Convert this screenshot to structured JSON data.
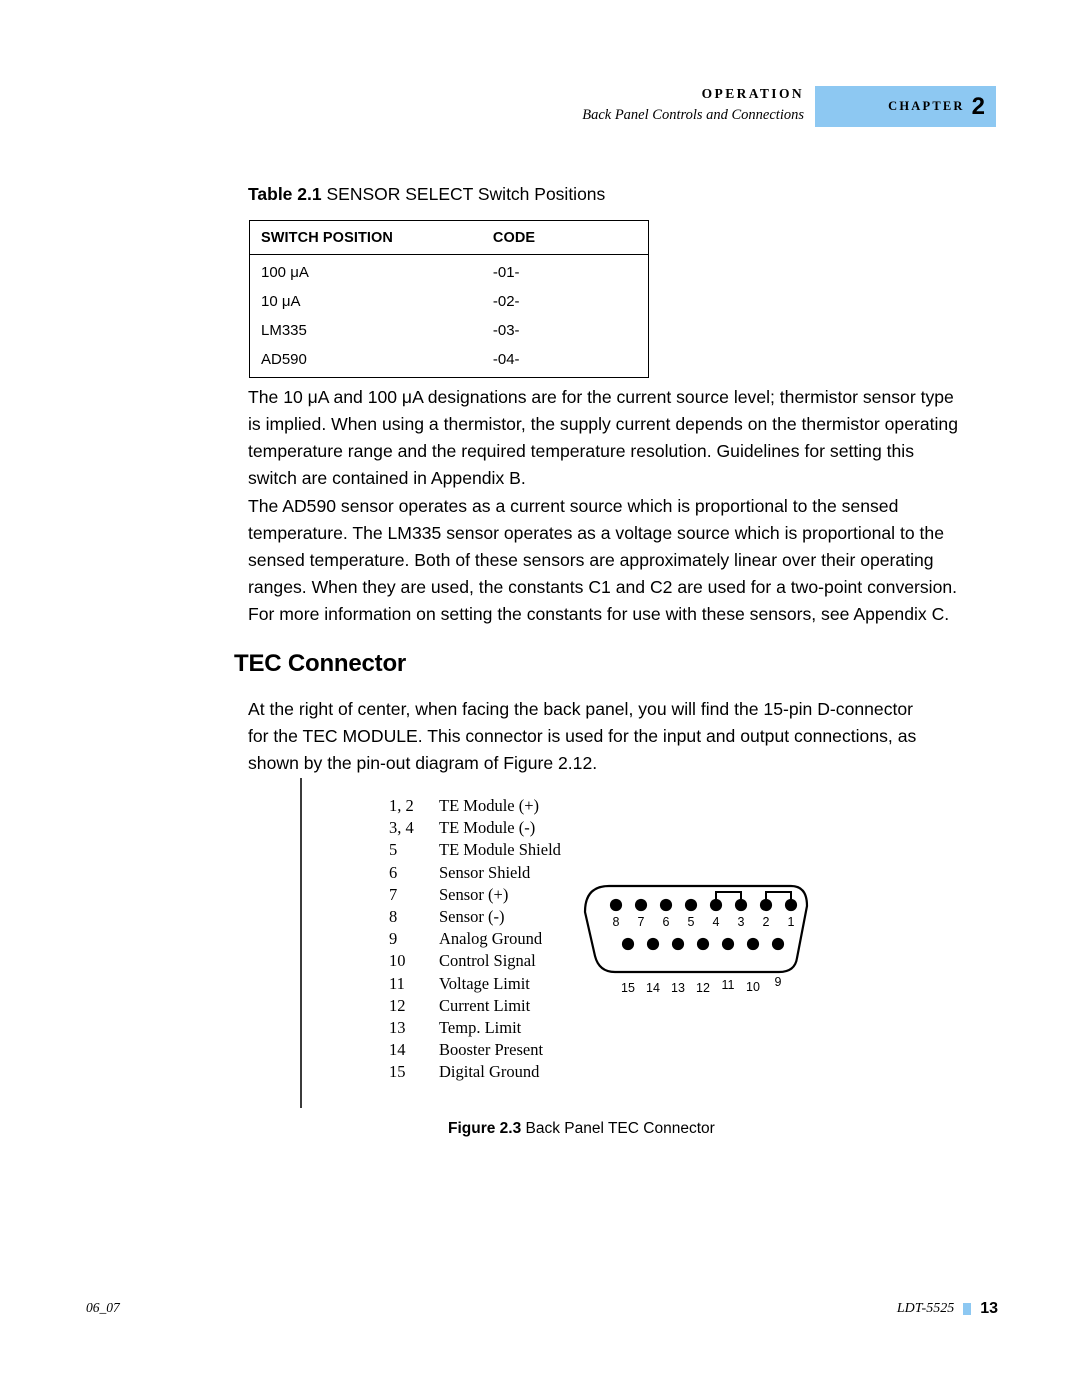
{
  "header": {
    "operation": "OPERATION",
    "subtitle": "Back Panel Controls and Connections",
    "chapter_word": "CHAPTER",
    "chapter_number": "2",
    "banner_color": "#8dc8f2"
  },
  "table_block": {
    "caption_label": "Table 2.1",
    "caption_text": "SENSOR SELECT Switch Positions",
    "columns": [
      "SWITCH POSITION",
      "CODE"
    ],
    "rows": [
      {
        "position": "100 μA",
        "code": "-01-"
      },
      {
        "position": "10 μA",
        "code": "-02-"
      },
      {
        "position": "LM335",
        "code": "-03-"
      },
      {
        "position": "AD590",
        "code": "-04-"
      }
    ]
  },
  "paragraphs": {
    "p1": "The 10 μA and 100 μA designations are for the current source level; thermistor sensor type is implied. When using a thermistor, the supply current depends on the thermistor operating temperature range and the required temperature resolution. Guidelines for setting this switch are contained in Appendix B.",
    "p2": "The AD590 sensor operates as a current source which is proportional to the sensed temperature. The LM335 sensor operates as a voltage source which is proportional to the sensed temperature. Both of these sensors are approximately linear over their operating ranges. When they are used, the constants C1 and C2 are used for a two-point conversion. For more information on setting the constants for use with these sensors, see Appendix C.",
    "p3": "At the right of center, when facing the back panel, you will find the 15-pin D-connector for the TEC MODULE. This connector is used for the input and output connections, as shown by the pin-out diagram of Figure 2.12."
  },
  "section": {
    "heading": "TEC Connector"
  },
  "figure": {
    "caption_label": "Figure 2.3",
    "caption_text": "Back Panel TEC Connector",
    "pin_list": [
      {
        "num": "1, 2",
        "label": "TE Module (+)"
      },
      {
        "num": "3, 4",
        "label": "TE Module (-)"
      },
      {
        "num": "5",
        "label": "TE Module Shield"
      },
      {
        "num": "6",
        "label": "Sensor Shield"
      },
      {
        "num": "7",
        "label": "Sensor (+)"
      },
      {
        "num": "8",
        "label": "Sensor (-)"
      },
      {
        "num": "9",
        "label": "Analog Ground"
      },
      {
        "num": "10",
        "label": "Control Signal"
      },
      {
        "num": "11",
        "label": "Voltage Limit"
      },
      {
        "num": "12",
        "label": "Current Limit"
      },
      {
        "num": "13",
        "label": "Temp. Limit"
      },
      {
        "num": "14",
        "label": "Booster Present"
      },
      {
        "num": "15",
        "label": "Digital Ground"
      }
    ],
    "connector": {
      "top_row_labels": [
        "8",
        "7",
        "6",
        "5",
        "4",
        "3",
        "2",
        "1"
      ],
      "bottom_row_labels": [
        "15",
        "14",
        "13",
        "12",
        "11",
        "10",
        "9"
      ],
      "bridges": [
        [
          "4",
          "3"
        ],
        [
          "2",
          "1"
        ]
      ]
    }
  },
  "footer": {
    "left": "06_07",
    "model": "LDT-5525",
    "page": "13",
    "marker_color": "#8dc8f2"
  }
}
